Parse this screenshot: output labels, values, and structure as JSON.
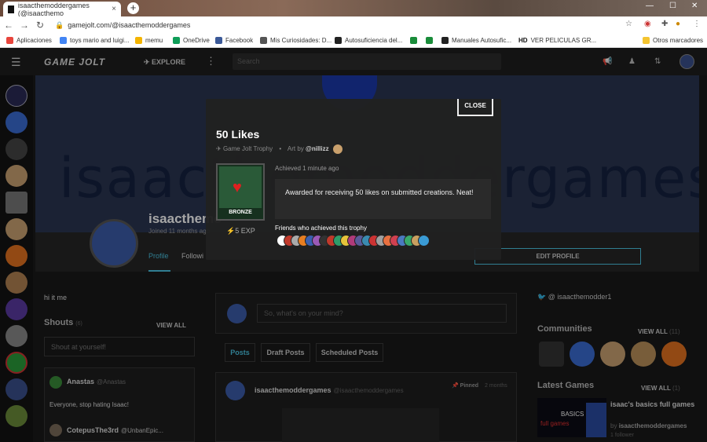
{
  "browser": {
    "tab_title": "isaacthemoddergames (@isaacthemo",
    "tab_close": "×",
    "new_tab": "+",
    "url": "gamejolt.com/@isaacthemoddergames",
    "bookmarks": [
      {
        "label": "Aplicaciones",
        "color": "#e8453c"
      },
      {
        "label": "toys mario and luigi...",
        "color": "#4285f4"
      },
      {
        "label": "memu",
        "color": "#f4b400"
      },
      {
        "label": "OneDrive",
        "color": "#0f9d58"
      },
      {
        "label": "Facebook",
        "color": "#3b5998"
      },
      {
        "label": "Mis Curiosidades: D...",
        "color": "#555555"
      },
      {
        "label": "Autosuficiencia del...",
        "color": "#222222"
      },
      {
        "label": "",
        "color": "#1a8c3a"
      },
      {
        "label": "",
        "color": "#1a8c3a"
      },
      {
        "label": "Manuales Autosufic...",
        "color": "#222222"
      },
      {
        "label": "VER PELICULAS GR...",
        "color": "#1a3a8a"
      },
      {
        "label": "Otros marcadores",
        "color": "#f4c430"
      }
    ],
    "hd_label": "HD"
  },
  "site": {
    "logo": "GAME JOLT",
    "explore": "EXPLORE",
    "search_placeholder": "Search"
  },
  "profile": {
    "banner_text": "isaacthemoddergames",
    "name": "isaacthemo",
    "joined": "Joined 11 months ago",
    "tab_profile": "Profile",
    "tab_following": "Followi",
    "edit_profile": "EDIT PROFILE",
    "bio": "hi it me"
  },
  "shouts": {
    "title": "Shouts",
    "count": "(6)",
    "view_all": "VIEW ALL",
    "placeholder": "Shout at yourself!",
    "items": [
      {
        "name": "Anastas",
        "handle": "@Anastas",
        "text": "Everyone, stop hating Isaac!",
        "color": "#3a8a3a"
      },
      {
        "name": "CotepusThe3rd",
        "handle": "@UnbanEpic...",
        "text": "",
        "color": "#7a6a5a"
      }
    ]
  },
  "feed": {
    "post_placeholder": "So, what's on your mind?",
    "tabs": [
      "Posts",
      "Draft Posts",
      "Scheduled Posts"
    ],
    "post": {
      "name": "isaacthemoddergames",
      "handle": "@isaacthemoddergames",
      "pinned": "Pinned",
      "ago": "2 months"
    }
  },
  "sidebar_right": {
    "twitter": "@ isaacthemodder1",
    "communities_title": "Communities",
    "communities_view_all": "VIEW ALL",
    "communities_count": "(11)",
    "latest_games_title": "Latest Games",
    "latest_games_view_all": "VIEW ALL",
    "latest_games_count": "(1)",
    "game": {
      "title": "isaac's basics full games",
      "by_prefix": "by",
      "by": "isaacthemoddergames",
      "followers": "1 follower",
      "thumb_basics": "BASICS",
      "thumb_full": "full games"
    }
  },
  "modal": {
    "close": "CLOSE",
    "title": "50 Likes",
    "type": "Game Jolt Trophy",
    "art_by_prefix": "Art by",
    "art_by": "@nillizz",
    "tier": "BRONZE",
    "exp": "5 EXP",
    "achieved": "Achieved 1 minute ago",
    "description": "Awarded for receiving 50 likes on submitted creations. Neat!",
    "friends_label": "Friends who achieved this trophy",
    "friend_colors": [
      "#ffffff",
      "#c0392b",
      "#aaaaaa",
      "#e67e22",
      "#3a5fb0",
      "#9b59b6",
      "#333333",
      "#c0392b",
      "#2e9c6a",
      "#e6c33a",
      "#b03a7a",
      "#5a5a9a",
      "#3a8ab0",
      "#cc3333",
      "#a0a0a0",
      "#e87040",
      "#d04050",
      "#4a7ac0",
      "#39a86b",
      "#c8a060",
      "#3a9bd5"
    ]
  },
  "colors": {
    "accent": "#4ac2e0",
    "bg": "#191919"
  }
}
